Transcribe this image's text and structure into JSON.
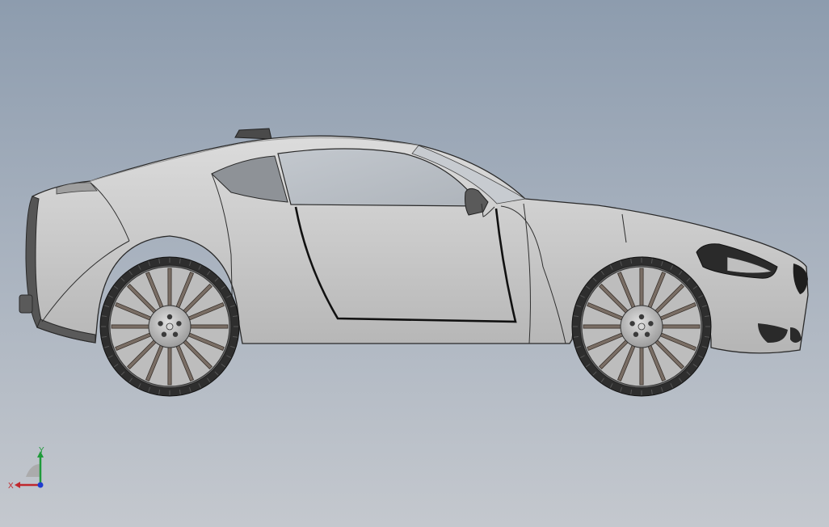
{
  "viewport": {
    "background_top": "#8d9cae",
    "background_bottom": "#c4c8ce"
  },
  "model": {
    "body_color": "#c9c9c9",
    "glass_color": "#bcc2c8",
    "tire_color": "#2e2e2e",
    "spoke_color": "#7a6e65",
    "hub_color": "#b8b8b8",
    "spoke_count": 16
  },
  "triad": {
    "x_label": "X",
    "y_label": "Y",
    "x_color": "#c0272d",
    "y_color": "#1f9a3a",
    "z_color": "#1f3ccf",
    "x_icon": "x-axis-arrow",
    "y_icon": "y-axis-arrow",
    "z_icon": "z-axis-dot"
  }
}
